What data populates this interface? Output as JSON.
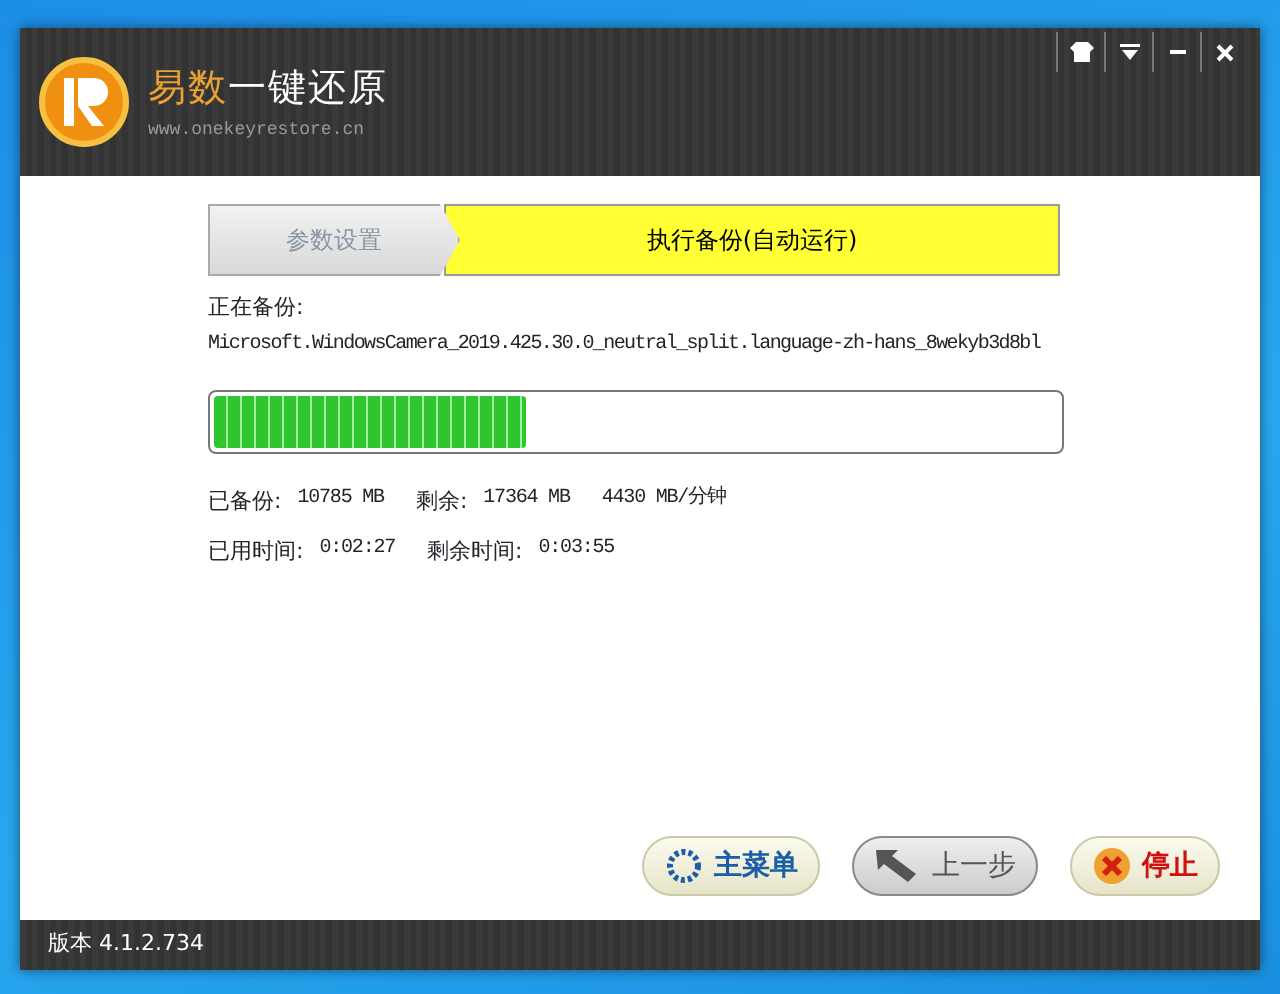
{
  "header": {
    "title_parts": [
      "易数",
      "一键还原"
    ],
    "url": "www.onekeyrestore.cn"
  },
  "steps": [
    {
      "label": "参数设置",
      "selected": false
    },
    {
      "label": "执行备份(自动运行)",
      "selected": true
    }
  ],
  "current": {
    "label": "正在备份:",
    "file": "Microsoft.WindowsCamera_2019.425.30.0_neutral_split.language-zh-hans_8wekyb3d8bl"
  },
  "progress": {
    "level": 0.37
  },
  "stats": [
    {
      "label": "已备份:",
      "value": "10785 MB"
    },
    {
      "label": "剩余:",
      "value": "17364 MB"
    },
    {
      "value": "4430 MB/分钟"
    }
  ],
  "times": [
    {
      "label": "已用时间:",
      "value": "0:02:27"
    },
    {
      "label": "剩余时间:",
      "value": "0:03:55"
    }
  ],
  "buttons": [
    {
      "kind": "menu",
      "label": "主菜单",
      "disabled": false
    },
    {
      "kind": "back",
      "label": "上一步",
      "disabled": true
    },
    {
      "kind": "stop",
      "label": "停止",
      "disabled": false
    }
  ],
  "status_bar": {
    "version": "版本 4.1.2.734"
  }
}
